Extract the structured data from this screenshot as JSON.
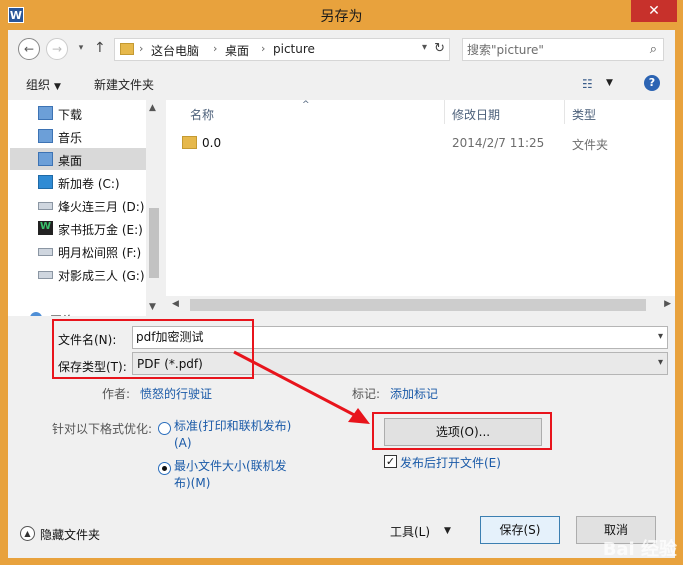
{
  "window": {
    "title": "另存为",
    "app_icon_letter": "W",
    "close_glyph": "✕"
  },
  "nav": {
    "back_glyph": "←",
    "forward_glyph": "→",
    "up_glyph": "↑",
    "breadcrumb": [
      "这台电脑",
      "桌面",
      "picture"
    ],
    "separator": "›",
    "dropdown_glyph": "▾",
    "refresh_glyph": "↻",
    "search_placeholder": "搜索\"picture\"",
    "search_glyph": "⌕"
  },
  "toolbar": {
    "organize_label": "组织",
    "organize_caret": "▼",
    "new_folder_label": "新建文件夹",
    "view_glyph": "☷",
    "view_caret": "▼",
    "help_glyph": "?"
  },
  "sidebar": {
    "items": [
      {
        "label": "下载",
        "icon": "folder-icon"
      },
      {
        "label": "音乐",
        "icon": "folder-icon"
      },
      {
        "label": "桌面",
        "icon": "folder-icon",
        "selected": true
      },
      {
        "label": "新加卷 (C:)",
        "icon": "windows-drive-icon"
      },
      {
        "label": "烽火连三月 (D:)",
        "icon": "drive-icon"
      },
      {
        "label": "家书抵万金 (E:)",
        "icon": "app-drive-icon"
      },
      {
        "label": "明月松间照 (F:)",
        "icon": "drive-icon"
      },
      {
        "label": "对影成三人 (G:)",
        "icon": "drive-icon"
      }
    ],
    "partial_item_label": "网络",
    "scroll_up_glyph": "▲",
    "scroll_down_glyph": "▼",
    "app_drive_glyph": "W"
  },
  "filelist": {
    "columns": [
      "名称",
      "修改日期",
      "类型"
    ],
    "sort_glyph": "^",
    "rows": [
      {
        "name": "0.0",
        "date": "2014/2/7 11:25",
        "type": "文件夹"
      }
    ],
    "scroll_left_glyph": "◀",
    "scroll_right_glyph": "▶"
  },
  "form": {
    "filename_label": "文件名(N):",
    "filename_value": "pdf加密测试",
    "filetype_label": "保存类型(T):",
    "filetype_value": "PDF (*.pdf)",
    "dropdown_glyph": "▾",
    "author_label": "作者:",
    "author_value": "愤怒的行驶证",
    "tags_label": "标记:",
    "tags_value": "添加标记",
    "optimize_label": "针对以下格式优化:",
    "option_standard": "标准(打印和联机发布)(A)",
    "option_minimum": "最小文件大小(联机发布)(M)",
    "selected_option": "minimum",
    "options_button": "选项(O)...",
    "open_after_label": "发布后打开文件(E)",
    "open_after_checked": true,
    "check_glyph": "✓"
  },
  "footer": {
    "hide_folders_label": "隐藏文件夹",
    "hide_folders_glyph": "▲",
    "tools_label": "工具(L)",
    "tools_caret": "▼",
    "save_button": "保存(S)",
    "cancel_button": "取消"
  },
  "annotations": {
    "highlight_color": "#e8141c"
  },
  "watermark": {
    "text": "Bai 经验"
  }
}
